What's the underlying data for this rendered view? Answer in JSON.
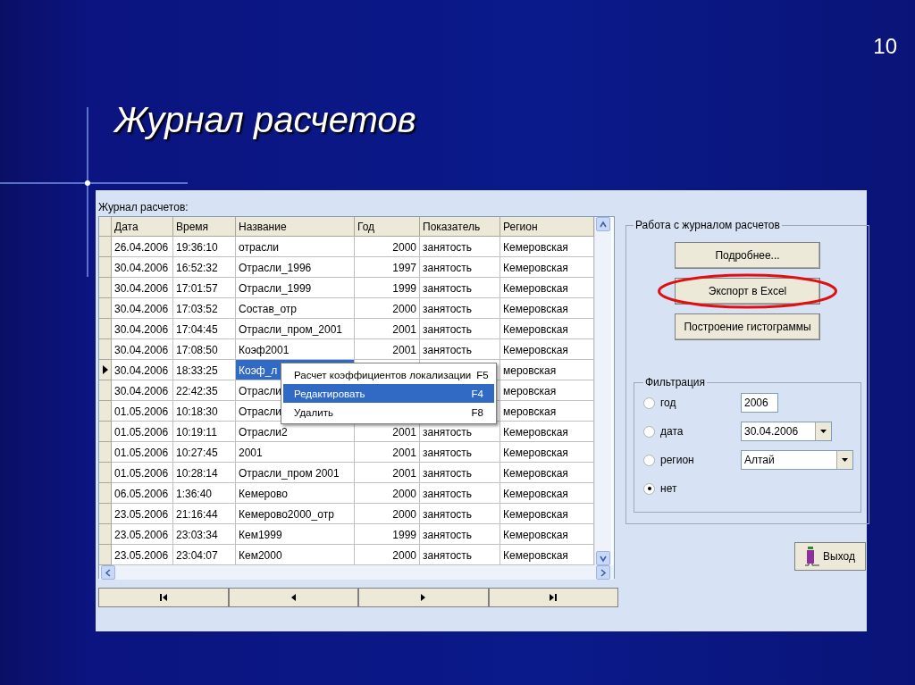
{
  "slide": {
    "number": "10",
    "title": "Журнал расчетов"
  },
  "journal": {
    "label": "Журнал расчетов:",
    "columns": [
      "Дата",
      "Время",
      "Название",
      "Год",
      "Показатель",
      "Регион"
    ],
    "rows": [
      {
        "selected": false,
        "cells": {
          "date": "26.04.2006",
          "time": "19:36:10",
          "name": "отрасли",
          "year": "2000",
          "indicator": "занятость",
          "region": "Кемеровская"
        }
      },
      {
        "selected": false,
        "cells": {
          "date": "30.04.2006",
          "time": "16:52:32",
          "name": "Отрасли_1996",
          "year": "1997",
          "indicator": "занятость",
          "region": "Кемеровская"
        }
      },
      {
        "selected": false,
        "cells": {
          "date": "30.04.2006",
          "time": "17:01:57",
          "name": "Отрасли_1999",
          "year": "1999",
          "indicator": "занятость",
          "region": "Кемеровская"
        }
      },
      {
        "selected": false,
        "cells": {
          "date": "30.04.2006",
          "time": "17:03:52",
          "name": "Состав_отр",
          "year": "2000",
          "indicator": "занятость",
          "region": "Кемеровская"
        }
      },
      {
        "selected": false,
        "cells": {
          "date": "30.04.2006",
          "time": "17:04:45",
          "name": "Отрасли_пром_2001",
          "year": "2001",
          "indicator": "занятость",
          "region": "Кемеровская"
        }
      },
      {
        "selected": false,
        "cells": {
          "date": "30.04.2006",
          "time": "17:08:50",
          "name": "Коэф2001",
          "year": "2001",
          "indicator": "занятость",
          "region": "Кемеровская"
        }
      },
      {
        "selected": true,
        "cells": {
          "date": "30.04.2006",
          "time": "18:33:25",
          "name": "Коэф_л",
          "region": "меровская"
        }
      },
      {
        "selected": false,
        "cells": {
          "date": "30.04.2006",
          "time": "22:42:35",
          "name": "Отрасли",
          "region": "меровская"
        }
      },
      {
        "selected": false,
        "cells": {
          "date": "01.05.2006",
          "time": "10:18:30",
          "name": "Отрасли",
          "region": "меровская"
        }
      },
      {
        "selected": false,
        "cells": {
          "date": "01.05.2006",
          "time": "10:19:11",
          "name": "Отрасли2",
          "year": "2001",
          "indicator": "занятость",
          "region": "Кемеровская"
        }
      },
      {
        "selected": false,
        "cells": {
          "date": "01.05.2006",
          "time": "10:27:45",
          "name": "2001",
          "year": "2001",
          "indicator": "занятость",
          "region": "Кемеровская"
        }
      },
      {
        "selected": false,
        "cells": {
          "date": "01.05.2006",
          "time": "10:28:14",
          "name": "Отрасли_пром 2001",
          "year": "2001",
          "indicator": "занятость",
          "region": "Кемеровская"
        }
      },
      {
        "selected": false,
        "cells": {
          "date": "06.05.2006",
          "time": "1:36:40",
          "name": "Кемерово",
          "year": "2000",
          "indicator": "занятость",
          "region": "Кемеровская"
        }
      },
      {
        "selected": false,
        "cells": {
          "date": "23.05.2006",
          "time": "21:16:44",
          "name": "Кемерово2000_отр",
          "year": "2000",
          "indicator": "занятость",
          "region": "Кемеровская"
        }
      },
      {
        "selected": false,
        "cells": {
          "date": "23.05.2006",
          "time": "23:03:34",
          "name": "Кем1999",
          "year": "1999",
          "indicator": "занятость",
          "region": "Кемеровская"
        }
      },
      {
        "selected": false,
        "cells": {
          "date": "23.05.2006",
          "time": "23:04:07",
          "name": "Кем2000",
          "year": "2000",
          "indicator": "занятость",
          "region": "Кемеровская"
        }
      }
    ]
  },
  "context_menu": [
    {
      "label": "Расчет коэффициентов локализации",
      "shortcut": "F5",
      "selected": false
    },
    {
      "label": "Редактировать",
      "shortcut": "F4",
      "selected": true
    },
    {
      "label": "Удалить",
      "shortcut": "F8",
      "selected": false
    }
  ],
  "navigator": [
    {
      "kind": "first"
    },
    {
      "kind": "prev"
    },
    {
      "kind": "next"
    },
    {
      "kind": "last"
    }
  ],
  "journal_group": {
    "title": "Работа с журналом расчетов",
    "buttons": [
      {
        "label": "Подробнее...",
        "highlighted": false
      },
      {
        "label": "Экспорт в Excel",
        "highlighted": true
      },
      {
        "label": "Построение гистограммы",
        "highlighted": false
      }
    ]
  },
  "filter": {
    "title": "Фильтрация",
    "options": [
      {
        "label": "год",
        "selected": false,
        "kind": "text",
        "value": "2006"
      },
      {
        "label": "дата",
        "selected": false,
        "kind": "combo",
        "value": "30.04.2006"
      },
      {
        "label": "регион",
        "selected": false,
        "kind": "combo",
        "value": "Алтай"
      },
      {
        "label": "нет",
        "selected": true
      }
    ]
  },
  "exit_button": {
    "label": "Выход"
  }
}
